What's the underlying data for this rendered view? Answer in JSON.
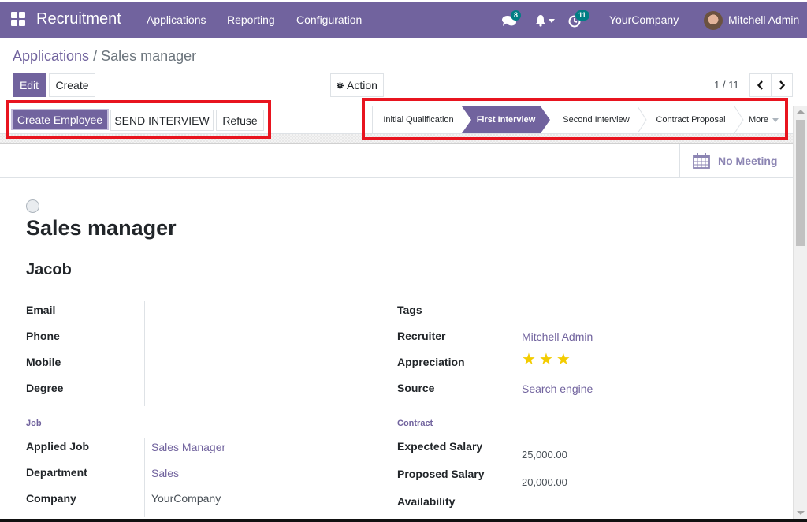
{
  "navbar": {
    "app_name": "Recruitment",
    "menu": [
      "Applications",
      "Reporting",
      "Configuration"
    ],
    "messages_count": "8",
    "activities_count": "11",
    "company": "YourCompany",
    "user": "Mitchell Admin"
  },
  "breadcrumb": {
    "parent": "Applications",
    "separator": "/",
    "current": "Sales manager"
  },
  "control_panel": {
    "edit_label": "Edit",
    "create_label": "Create",
    "action_label": "Action",
    "pager": "1 / 11"
  },
  "statusbar": {
    "buttons": [
      "Create Employee",
      "SEND INTERVIEW",
      "Refuse"
    ],
    "stages": [
      "Initial Qualification",
      "First Interview",
      "Second Interview",
      "Contract Proposal"
    ],
    "active_stage": "First Interview",
    "more_label": "More"
  },
  "smart_button": {
    "label": "No Meeting"
  },
  "record": {
    "title": "Sales manager",
    "applicant_name": "Jacob",
    "left_fields": [
      {
        "label": "Email",
        "value": ""
      },
      {
        "label": "Phone",
        "value": ""
      },
      {
        "label": "Mobile",
        "value": ""
      },
      {
        "label": "Degree",
        "value": ""
      }
    ],
    "right_fields": [
      {
        "label": "Tags",
        "value": ""
      },
      {
        "label": "Recruiter",
        "value": "Mitchell Admin"
      },
      {
        "label": "Appreciation",
        "value": "3 of 3 stars"
      },
      {
        "label": "Source",
        "value": "Search engine"
      }
    ],
    "appreciation_stars": 3,
    "job_group": {
      "title": "Job",
      "fields": [
        {
          "label": "Applied Job",
          "value": "Sales Manager"
        },
        {
          "label": "Department",
          "value": "Sales"
        },
        {
          "label": "Company",
          "value": "YourCompany"
        }
      ]
    },
    "contract_group": {
      "title": "Contract",
      "fields": [
        {
          "label": "Expected Salary",
          "value": "25,000.00"
        },
        {
          "label": "Proposed Salary",
          "value": "20,000.00"
        },
        {
          "label": "Availability",
          "value": ""
        }
      ]
    }
  },
  "colors": {
    "brand": "#71639e",
    "badge": "#017e84",
    "star": "#f3cc00",
    "highlight_box": "#e8141f"
  }
}
